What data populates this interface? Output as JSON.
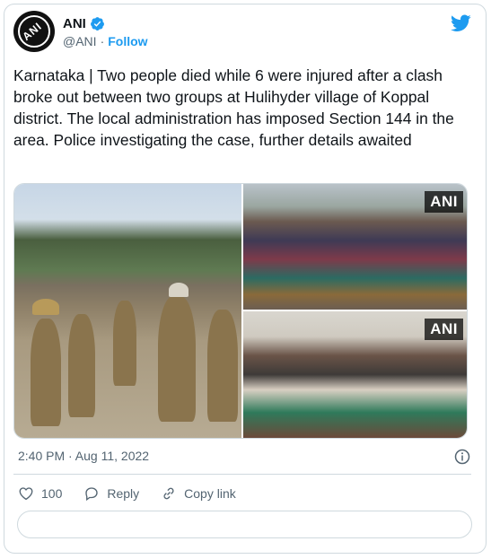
{
  "tweet": {
    "author": {
      "name": "ANI",
      "handle": "@ANI",
      "separator": "·",
      "follow_label": "Follow",
      "avatar_text": "ANI",
      "verified_icon": "verified-badge-icon"
    },
    "platform_icon": "twitter-bird-icon",
    "text": "Karnataka | Two people died while 6 were injured after a clash broke out between two groups at Hulihyder village of Koppal district. The local administration has imposed Section 144 in the area. Police investigating the case, further details awaited",
    "media": [
      {
        "label": "",
        "icon": "photo-police-crowd"
      },
      {
        "label": "ANI",
        "icon": "photo-villagers"
      },
      {
        "label": "ANI",
        "icon": "photo-relatives-mourning"
      }
    ],
    "timestamp": "2:40 PM · Aug 11, 2022",
    "actions": {
      "like_count": "100",
      "reply_label": "Reply",
      "copy_link_label": "Copy link"
    }
  },
  "colors": {
    "accent": "#1d9bf0",
    "text": "#0f1419",
    "secondary": "#536471",
    "border": "#cfd9de"
  }
}
